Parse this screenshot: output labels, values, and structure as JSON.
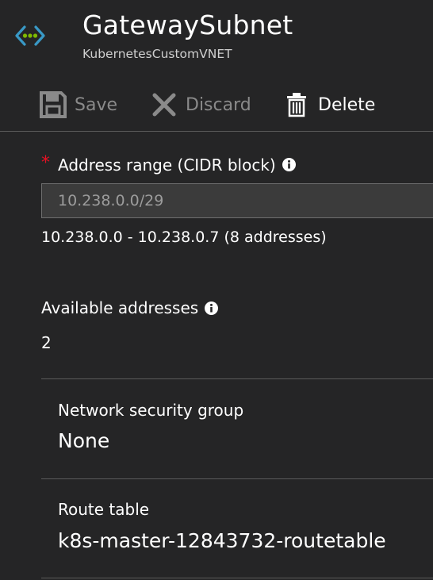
{
  "header": {
    "title": "GatewaySubnet",
    "subtitle": "KubernetesCustomVNET",
    "icon": "vnet-icon"
  },
  "toolbar": {
    "save_label": "Save",
    "discard_label": "Discard",
    "delete_label": "Delete"
  },
  "address_range": {
    "label": "Address range (CIDR block)",
    "required_marker": "*",
    "value": "10.238.0.0/29",
    "range_text": "10.238.0.0 - 10.238.0.7 (8 addresses)"
  },
  "available_addresses": {
    "label": "Available addresses",
    "value": "2"
  },
  "network_security_group": {
    "label": "Network security group",
    "value": "None"
  },
  "route_table": {
    "label": "Route table",
    "value": "k8s-master-12843732-routetable"
  },
  "colors": {
    "background": "#252526",
    "accent_blue": "#3999c6",
    "accent_green": "#7fba00",
    "required_red": "#e81123",
    "disabled_text": "#8a8a8a"
  }
}
